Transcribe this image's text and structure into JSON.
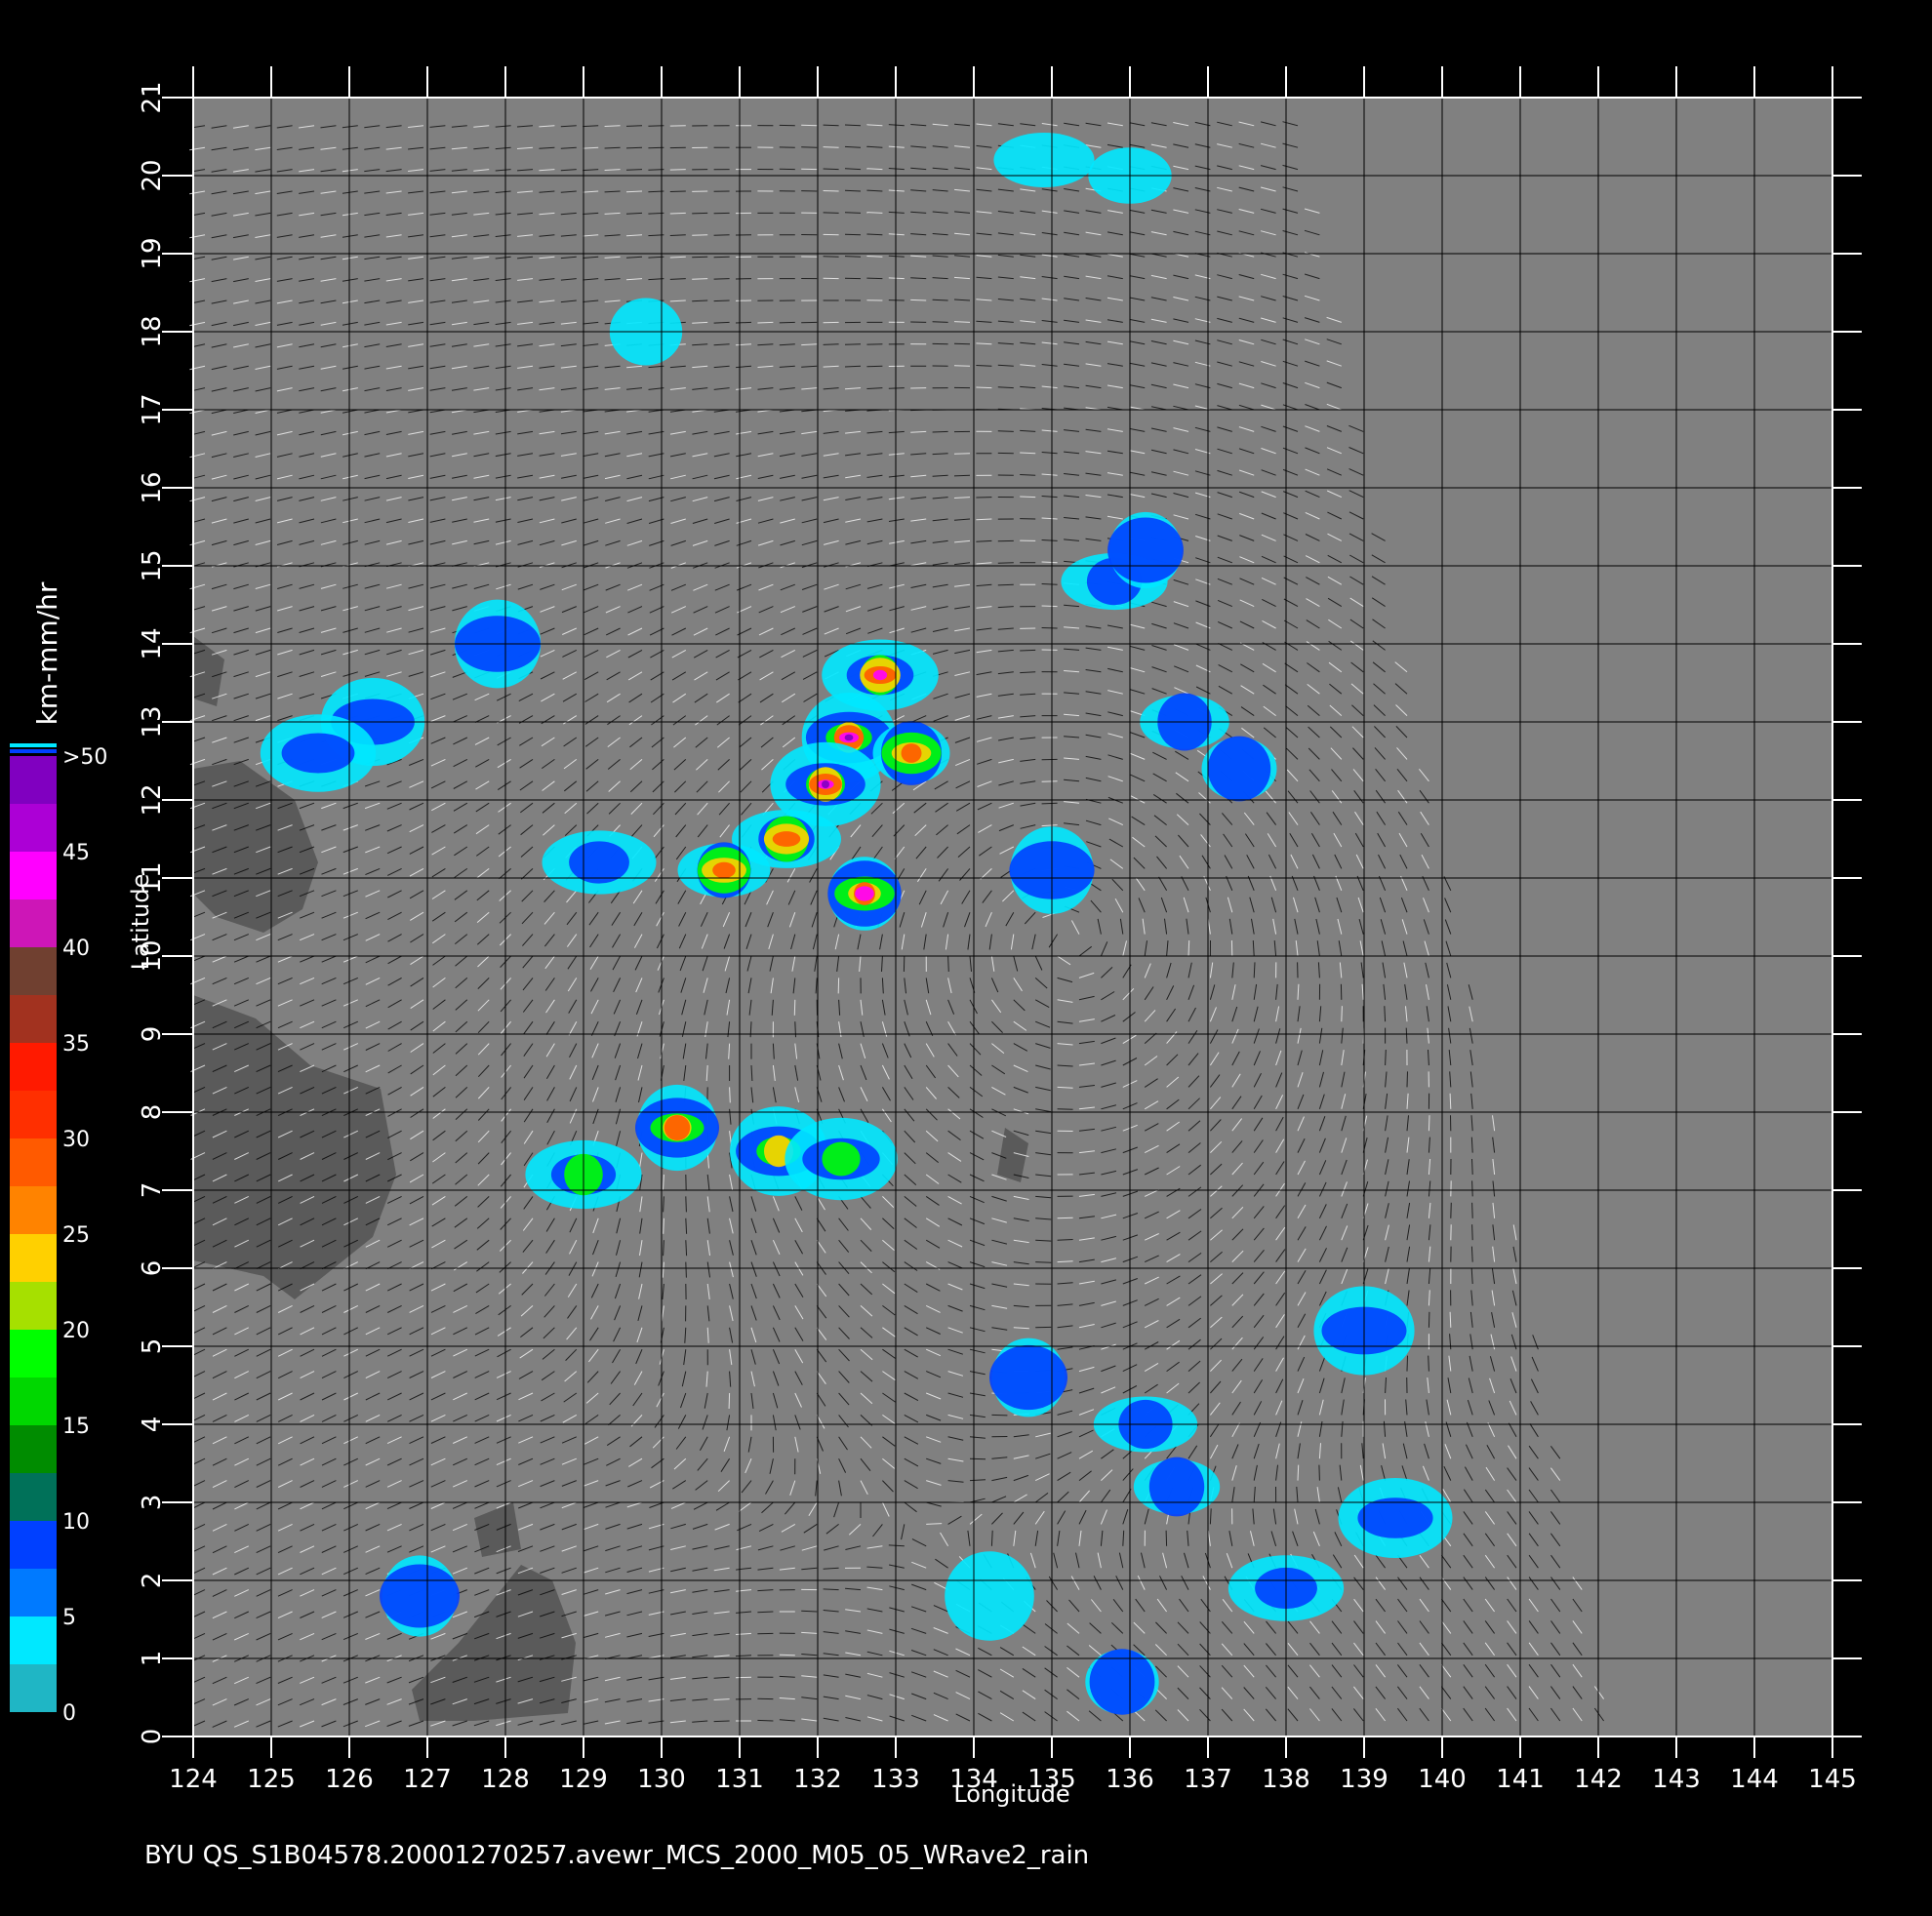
{
  "map": {
    "lon_min": 124,
    "lon_max": 145,
    "lat_min": 0,
    "lat_max": 21,
    "lon_ticks": [
      "124",
      "125",
      "126",
      "127",
      "128",
      "129",
      "130",
      "131",
      "132",
      "133",
      "134",
      "135",
      "136",
      "137",
      "138",
      "139",
      "140",
      "141",
      "142",
      "143",
      "144",
      "145"
    ],
    "lat_ticks": [
      "0",
      "1",
      "2",
      "3",
      "4",
      "5",
      "6",
      "7",
      "8",
      "9",
      "10",
      "11",
      "12",
      "13",
      "14",
      "15",
      "16",
      "17",
      "18",
      "19",
      "20",
      "21"
    ],
    "xlabel": "Longitude",
    "ylabel": "Latitude",
    "ocean_color": "#808080",
    "land_color": "#5a5a5a",
    "grid_color": "#000000",
    "barb_colors": [
      "#000000",
      "#ffffff"
    ],
    "swath_east_edge_note": "",
    "cyclone_center": {
      "lon": 135.2,
      "lat": 10.2
    }
  },
  "legend": {
    "unit_label": "km-mm/hr",
    "labels": [
      ">50",
      "45",
      "40",
      "35",
      "30",
      "25",
      "20",
      "15",
      "10",
      "5",
      "0"
    ],
    "colors": {
      "c0": "#5a5a5a",
      "c5": "#00e8ff",
      "c10": "#0040ff",
      "c15": "#008c00",
      "c20": "#00ff00",
      "c25": "#ffd000",
      "c30": "#ff5a00",
      "c35": "#ff1a00",
      "c40": "#704030",
      "c45": "#ff00ff",
      "c50": "#8000c0"
    }
  },
  "rain_cells": [
    {
      "lon": 132.4,
      "lat": 12.8,
      "level": 50
    },
    {
      "lon": 132.1,
      "lat": 12.2,
      "level": 50
    },
    {
      "lon": 132.8,
      "lat": 13.6,
      "level": 45
    },
    {
      "lon": 131.6,
      "lat": 11.5,
      "level": 40
    },
    {
      "lon": 130.8,
      "lat": 11.1,
      "level": 30
    },
    {
      "lon": 133.2,
      "lat": 12.6,
      "level": 35
    },
    {
      "lon": 132.6,
      "lat": 10.8,
      "level": 45
    },
    {
      "lon": 130.2,
      "lat": 7.8,
      "level": 35
    },
    {
      "lon": 131.5,
      "lat": 7.5,
      "level": 25
    },
    {
      "lon": 132.3,
      "lat": 7.4,
      "level": 20
    },
    {
      "lon": 129.0,
      "lat": 7.2,
      "level": 20
    },
    {
      "lon": 135.8,
      "lat": 14.8,
      "level": 15
    },
    {
      "lon": 136.7,
      "lat": 13.0,
      "level": 15
    },
    {
      "lon": 137.4,
      "lat": 12.4,
      "level": 15
    },
    {
      "lon": 136.2,
      "lat": 15.2,
      "level": 10
    },
    {
      "lon": 135.0,
      "lat": 11.1,
      "level": 10
    },
    {
      "lon": 139.0,
      "lat": 5.2,
      "level": 15
    },
    {
      "lon": 139.4,
      "lat": 2.8,
      "level": 15
    },
    {
      "lon": 138.0,
      "lat": 1.9,
      "level": 10
    },
    {
      "lon": 136.2,
      "lat": 4.0,
      "level": 10
    },
    {
      "lon": 136.6,
      "lat": 3.2,
      "level": 10
    },
    {
      "lon": 135.9,
      "lat": 0.7,
      "level": 10
    },
    {
      "lon": 134.7,
      "lat": 4.6,
      "level": 10
    },
    {
      "lon": 127.9,
      "lat": 14.0,
      "level": 10
    },
    {
      "lon": 126.3,
      "lat": 13.0,
      "level": 10
    },
    {
      "lon": 125.6,
      "lat": 12.6,
      "level": 10
    },
    {
      "lon": 129.2,
      "lat": 11.2,
      "level": 10
    },
    {
      "lon": 134.9,
      "lat": 20.2,
      "level": 5
    },
    {
      "lon": 136.0,
      "lat": 20.0,
      "level": 5
    },
    {
      "lon": 129.8,
      "lat": 18.0,
      "level": 5
    },
    {
      "lon": 126.9,
      "lat": 1.8,
      "level": 10
    },
    {
      "lon": 134.2,
      "lat": 1.8,
      "level": 5
    }
  ],
  "footer": {
    "caption": "BYU  QS_S1B04578.20001270257.avewr_MCS_2000_M05_05_WRave2_rain"
  }
}
